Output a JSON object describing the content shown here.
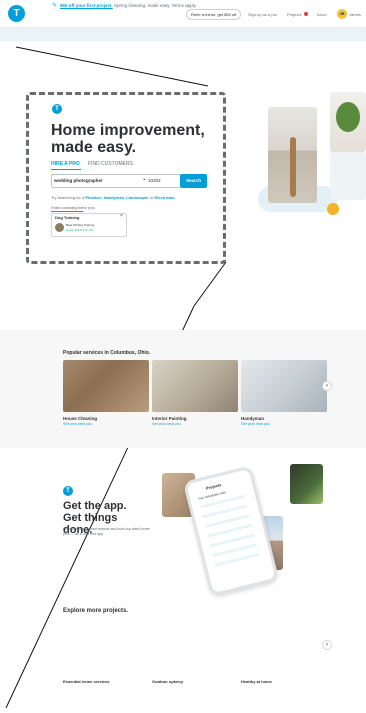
{
  "nav": {
    "logo": "T",
    "refer_label": "Refer a friend, get $50 off",
    "signup_label": "Sign up as a pro",
    "projects_label": "Projects",
    "inbox_label": "Inbox",
    "avatar_initial": "JR",
    "user_name": "James"
  },
  "promo": {
    "icon": "tag-icon",
    "link_text": "$50 off your first project.",
    "rest_text": " Spring cleaning, made easy. Terms apply."
  },
  "hero": {
    "logo": "T",
    "title": "Home improvement, made easy.",
    "tab_hire": "HIRE A PRO",
    "tab_find": "FIND CUSTOMERS",
    "search_value": "wedding photographer",
    "zip_value": "10203",
    "search_button": "Search",
    "try_prefix": "Try searching for a ",
    "try_links": [
      "Plumber",
      "Handyman",
      "Landscaper",
      "Electrician"
    ],
    "finish_text": "Finish contacting these pros",
    "pro_card": {
      "title": "Dog Training",
      "name": "Best K9 Dog Training",
      "rating": "Great ★★★★★ (62)"
    }
  },
  "popular": {
    "title": "Popular services in Columbus, Ohio.",
    "items": [
      {
        "label": "House Cleaning",
        "sub": "See pros near you"
      },
      {
        "label": "Interior Painting",
        "sub": "See pros near you"
      },
      {
        "label": "Handyman",
        "sub": "See pros near you"
      }
    ],
    "next_icon": "chevron-right-icon"
  },
  "app": {
    "logo": "T",
    "title": "Get the app. Get things done.",
    "description": "Compare prices, read reviews and book top-rated home pros — all in one free app.",
    "phone_title": "Projects",
    "phone_sub": "Your Scheduled Jobs"
  },
  "explore": {
    "title": "Explore more projects.",
    "items": [
      "Essential home services",
      "Outdoor upkeep",
      "Healthy at home"
    ],
    "next_icon": "chevron-right-icon"
  },
  "colors": {
    "brand": "#009fd9",
    "accent_yellow": "#f4b425",
    "text": "#2f3033"
  }
}
